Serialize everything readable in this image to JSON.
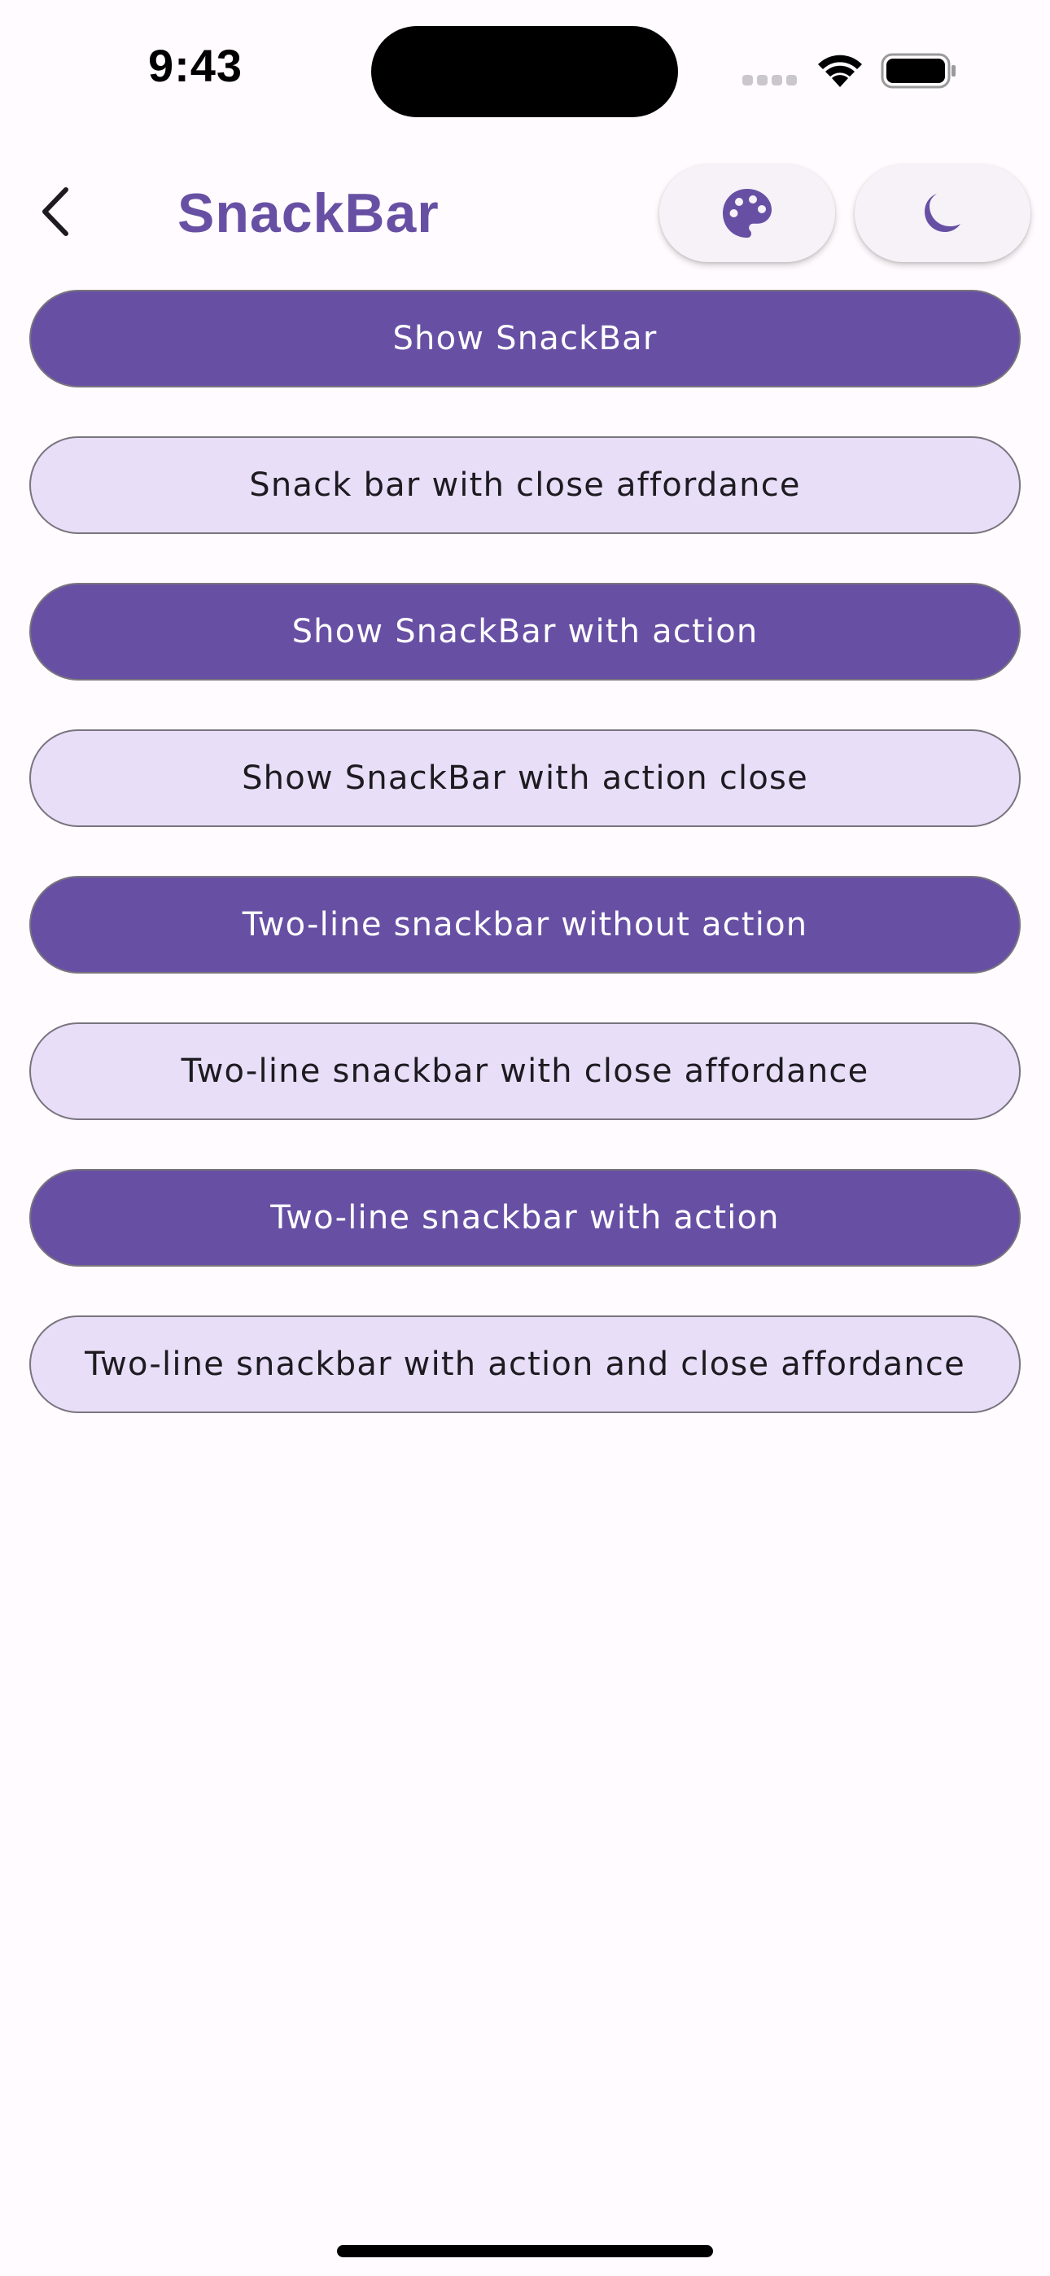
{
  "status_bar": {
    "time": "9:43"
  },
  "app_bar": {
    "title": "SnackBar",
    "back_icon": "chevron-left-icon",
    "palette_icon": "palette-icon",
    "theme_icon": "moon-icon"
  },
  "buttons": [
    {
      "label": "Show SnackBar",
      "style": "filled"
    },
    {
      "label": "Snack bar with close affordance",
      "style": "tonal"
    },
    {
      "label": "Show SnackBar with action",
      "style": "filled"
    },
    {
      "label": "Show SnackBar with action close",
      "style": "tonal"
    },
    {
      "label": "Two-line snackbar without action",
      "style": "filled"
    },
    {
      "label": "Two-line snackbar with close affordance",
      "style": "tonal"
    },
    {
      "label": "Two-line snackbar with action",
      "style": "filled"
    },
    {
      "label": "Two-line snackbar with action and close affordance",
      "style": "tonal"
    }
  ],
  "colors": {
    "primary": "#6750a4",
    "secondary_container": "#e8def8",
    "background": "#fffbfe"
  }
}
